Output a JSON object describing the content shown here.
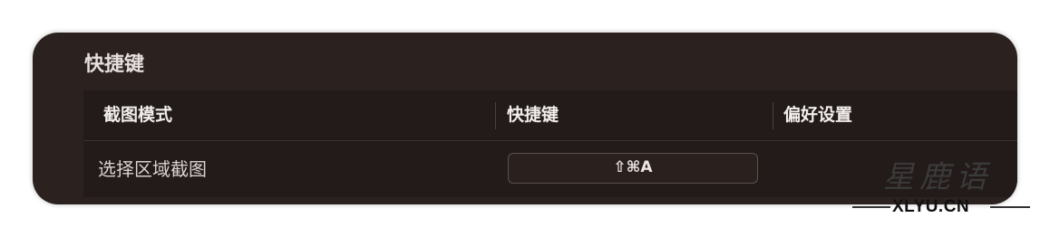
{
  "section": {
    "title": "快捷键"
  },
  "table": {
    "headers": {
      "mode": "截图模式",
      "shortcut": "快捷键",
      "preferences": "偏好设置"
    },
    "rows": [
      {
        "mode": "选择区域截图",
        "shortcut": "⇧⌘A",
        "preferences": ""
      }
    ]
  },
  "watermark": {
    "chars": "星鹿语",
    "url": "XLYU.CN"
  },
  "colors": {
    "panel_bg": "#2b2220",
    "table_bg": "#231b19",
    "text_primary": "#f2eeec",
    "text_secondary": "#d8d1cf"
  }
}
